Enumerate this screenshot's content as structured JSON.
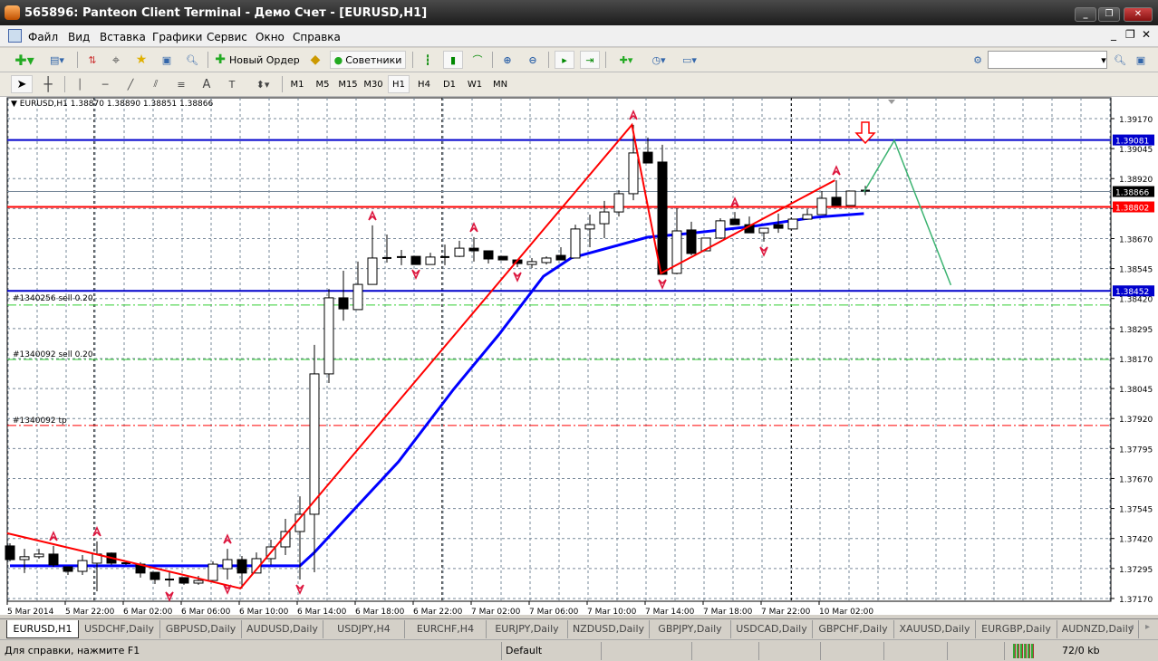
{
  "window": {
    "title": "565896: Panteon Client Terminal - Демо Счет - [EURUSD,H1]",
    "min": "_",
    "restore": "❐",
    "close": "✕"
  },
  "menu": [
    "Файл",
    "Вид",
    "Вставка",
    "Графики",
    "Сервис",
    "Окно",
    "Справка"
  ],
  "toolbar": {
    "new_order": "Новый Ордер",
    "experts": "Советники",
    "search_placeholder": ""
  },
  "timeframes": [
    "M1",
    "M5",
    "M15",
    "M30",
    "H1",
    "H4",
    "D1",
    "W1",
    "MN"
  ],
  "active_timeframe": "H1",
  "chart": {
    "header": "EURUSD,H1  1.38870 1.38890 1.38851 1.38866",
    "orders": [
      "#1340256 sell 0.20",
      "#1340092 sell 0.20",
      "#1340092 tp"
    ]
  },
  "colors": {
    "bull": "#ffffff",
    "bear": "#000000",
    "zigzag": "#ff0000",
    "ma": "#0000ff",
    "projection": "#3cb371",
    "grid": "#778899",
    "blue_line": "#0000cc",
    "red_line": "#ff0000"
  },
  "chart_data": {
    "type": "candlestick",
    "symbol": "EURUSD",
    "timeframe": "H1",
    "ylim": [
      1.3717,
      1.3917
    ],
    "yticks": [
      "1.39170",
      "1.39045",
      "1.38920",
      "1.38795",
      "1.38670",
      "1.38545",
      "1.38420",
      "1.38295",
      "1.38170",
      "1.38045",
      "1.37920",
      "1.37795",
      "1.37670",
      "1.37545",
      "1.37420",
      "1.37295",
      "1.37170"
    ],
    "xticks": [
      "5 Mar 2014",
      "5 Mar 22:00",
      "6 Mar 02:00",
      "6 Mar 06:00",
      "6 Mar 10:00",
      "6 Mar 14:00",
      "6 Mar 18:00",
      "6 Mar 22:00",
      "7 Mar 02:00",
      "7 Mar 06:00",
      "7 Mar 10:00",
      "7 Mar 14:00",
      "7 Mar 18:00",
      "7 Mar 22:00",
      "10 Mar 02:00"
    ],
    "ohlc": [
      [
        1.37389,
        1.374,
        1.37325,
        1.37332
      ],
      [
        1.37332,
        1.37377,
        1.37276,
        1.37344
      ],
      [
        1.37344,
        1.37377,
        1.37336,
        1.37355
      ],
      [
        1.37355,
        1.37389,
        1.37302,
        1.3731
      ],
      [
        1.37302,
        1.37302,
        1.37268,
        1.37283
      ],
      [
        1.37283,
        1.37351,
        1.37268,
        1.37328
      ],
      [
        1.37317,
        1.37408,
        1.372,
        1.37355
      ],
      [
        1.37359,
        1.37362,
        1.3731,
        1.37317
      ],
      [
        1.37317,
        1.37325,
        1.3731,
        1.37317
      ],
      [
        1.37313,
        1.37321,
        1.37257,
        1.37276
      ],
      [
        1.37279,
        1.37279,
        1.3723,
        1.37249
      ],
      [
        1.37249,
        1.37279,
        1.37219,
        1.37245
      ],
      [
        1.37257,
        1.37257,
        1.37227,
        1.37234
      ],
      [
        1.37234,
        1.37264,
        1.37227,
        1.37245
      ],
      [
        1.37245,
        1.37325,
        1.37245,
        1.37313
      ],
      [
        1.37294,
        1.37377,
        1.37249,
        1.37332
      ],
      [
        1.37332,
        1.37347,
        1.37212,
        1.37276
      ],
      [
        1.37276,
        1.37362,
        1.37276,
        1.37336
      ],
      [
        1.37336,
        1.37415,
        1.3731,
        1.37385
      ],
      [
        1.37385,
        1.37502,
        1.37351,
        1.37449
      ],
      [
        1.37449,
        1.37596,
        1.37249,
        1.37521
      ],
      [
        1.37521,
        1.38227,
        1.37279,
        1.38106
      ],
      [
        1.38106,
        1.3846,
        1.38068,
        1.38423
      ],
      [
        1.38423,
        1.38536,
        1.38328,
        1.38377
      ],
      [
        1.38374,
        1.38574,
        1.38374,
        1.38479
      ],
      [
        1.38479,
        1.38725,
        1.38479,
        1.38589
      ],
      [
        1.38589,
        1.38687,
        1.3857,
        1.38589
      ],
      [
        1.38593,
        1.38623,
        1.38559,
        1.38593
      ],
      [
        1.38596,
        1.38596,
        1.38562,
        1.38562
      ],
      [
        1.38562,
        1.38611,
        1.38562,
        1.38593
      ],
      [
        1.38593,
        1.38645,
        1.38559,
        1.38593
      ],
      [
        1.38596,
        1.38661,
        1.38593,
        1.3863
      ],
      [
        1.3863,
        1.38676,
        1.38574,
        1.38619
      ],
      [
        1.38619,
        1.38619,
        1.38566,
        1.38585
      ],
      [
        1.38596,
        1.38596,
        1.38581,
        1.38581
      ],
      [
        1.38581,
        1.38581,
        1.38551,
        1.38566
      ],
      [
        1.38562,
        1.38589,
        1.38547,
        1.38574
      ],
      [
        1.3857,
        1.38596,
        1.38562,
        1.38589
      ],
      [
        1.386,
        1.38634,
        1.38581,
        1.38581
      ],
      [
        1.38589,
        1.38728,
        1.38589,
        1.3871
      ],
      [
        1.3871,
        1.3877,
        1.38634,
        1.38728
      ],
      [
        1.38732,
        1.38827,
        1.38672,
        1.38781
      ],
      [
        1.38781,
        1.38872,
        1.38762,
        1.38857
      ],
      [
        1.38857,
        1.39144,
        1.3883,
        1.39027
      ],
      [
        1.3903,
        1.39091,
        1.38985,
        1.38985
      ],
      [
        1.38989,
        1.39061,
        1.38521,
        1.38521
      ],
      [
        1.38525,
        1.38796,
        1.38521,
        1.38702
      ],
      [
        1.38706,
        1.3874,
        1.386,
        1.38608
      ],
      [
        1.38619,
        1.38672,
        1.38619,
        1.38672
      ],
      [
        1.38672,
        1.38755,
        1.38672,
        1.38744
      ],
      [
        1.38751,
        1.38781,
        1.38728,
        1.38728
      ],
      [
        1.38728,
        1.38762,
        1.38694,
        1.38694
      ],
      [
        1.38694,
        1.38713,
        1.38657,
        1.38713
      ],
      [
        1.38728,
        1.38774,
        1.38694,
        1.38713
      ],
      [
        1.3871,
        1.38751,
        1.3871,
        1.38751
      ],
      [
        1.38751,
        1.38793,
        1.38751,
        1.3877
      ],
      [
        1.3877,
        1.38868,
        1.3877,
        1.38838
      ],
      [
        1.38842,
        1.38913,
        1.38808,
        1.38808
      ],
      [
        1.38808,
        1.38868,
        1.38808,
        1.38868
      ],
      [
        1.3887,
        1.3889,
        1.38851,
        1.38866
      ]
    ],
    "ma": [
      [
        0,
        1.37306
      ],
      [
        20,
        1.37306
      ],
      [
        21,
        1.37362
      ],
      [
        24,
        1.37558
      ],
      [
        26.8,
        1.3774
      ],
      [
        30.6,
        1.38042
      ],
      [
        33.7,
        1.38268
      ],
      [
        36.8,
        1.38513
      ],
      [
        38.7,
        1.38589
      ],
      [
        44,
        1.38676
      ],
      [
        46.8,
        1.38691
      ],
      [
        51.2,
        1.38721
      ],
      [
        55.6,
        1.38759
      ],
      [
        58.9,
        1.38774
      ]
    ],
    "zigzag": [
      [
        -0.2,
        1.37442
      ],
      [
        15.9,
        1.37212
      ],
      [
        42.9,
        1.39144
      ],
      [
        44.9,
        1.38525
      ],
      [
        56.9,
        1.38913
      ]
    ],
    "projection": [
      [
        58.9,
        1.38864
      ],
      [
        61,
        1.39079
      ],
      [
        64.9,
        1.38476
      ]
    ],
    "fractals_up": [
      3,
      6,
      15,
      25,
      32,
      43,
      50,
      57
    ],
    "fractals_down": [
      11,
      15,
      20,
      28,
      35,
      45,
      52
    ],
    "hlines": [
      {
        "price": 1.39081,
        "label": "1.39081",
        "color": "#0000cc"
      },
      {
        "price": 1.38452,
        "label": "1.38452",
        "color": "#0000cc"
      },
      {
        "price": 1.38802,
        "label": "1.38802",
        "color": "#ff0000"
      },
      {
        "price": 1.38866,
        "label": "1.38866",
        "color": "#000000"
      }
    ],
    "order_lines": [
      {
        "price": 1.38393,
        "color": "#32cd32"
      },
      {
        "price": 1.38166,
        "color": "#32cd32"
      },
      {
        "price": 1.37891,
        "color": "#ff0000"
      }
    ],
    "period_separators": [
      5.8,
      29.8,
      53.9
    ]
  },
  "tabs": [
    "EURUSD,H1",
    "USDCHF,Daily",
    "GBPUSD,Daily",
    "AUDUSD,Daily",
    "USDJPY,H4",
    "EURCHF,H4",
    "EURJPY,Daily",
    "NZDUSD,Daily",
    "GBPJPY,Daily",
    "USDCAD,Daily",
    "GBPCHF,Daily",
    "XAUUSD,Daily",
    "EURGBP,Daily",
    "AUDNZD,Daily"
  ],
  "status": {
    "help": "Для справки, нажмите F1",
    "profile": "Default",
    "traffic": "72/0 kb"
  }
}
